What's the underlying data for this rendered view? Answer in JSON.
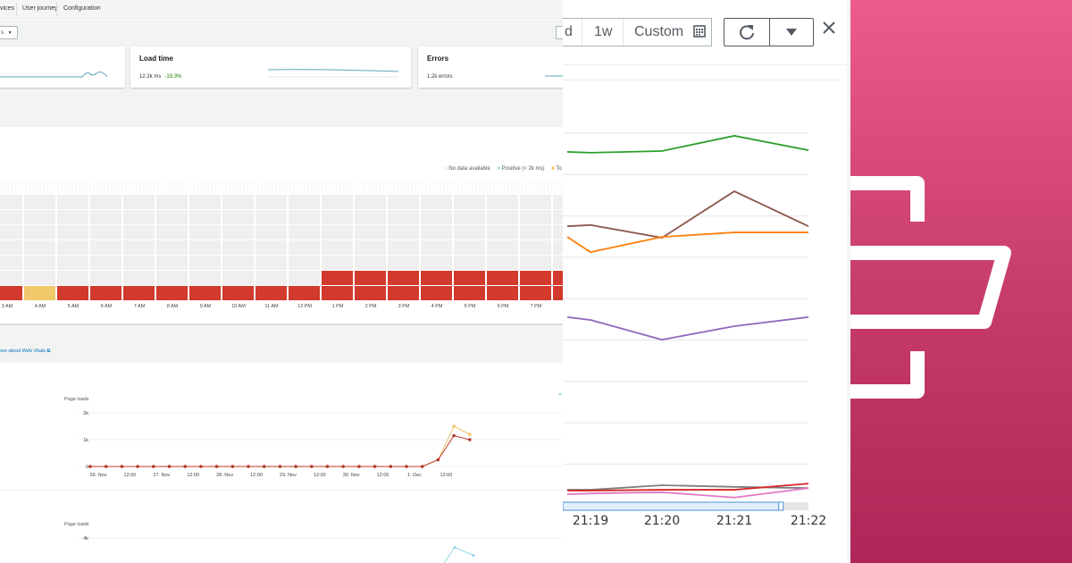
{
  "dashboard": {
    "tabs": [
      {
        "label": "vices"
      },
      {
        "label": "User journey"
      },
      {
        "label": "Configuration"
      }
    ],
    "filter_select": {
      "value": "s"
    },
    "cards": [
      {
        "title": "",
        "value": ""
      },
      {
        "title": "Load time",
        "value": "12.2k ms",
        "delta": "-19.3%"
      },
      {
        "title": "Errors",
        "value": "1.2k errors"
      }
    ],
    "legend": [
      {
        "label": "No data available",
        "color": "#e9ebed"
      },
      {
        "label": "Positive (< 2k ms)",
        "color": "#a8dcea"
      },
      {
        "label": "To",
        "color": "#f2c14e"
      }
    ],
    "heatmap": {
      "colors": {
        "none": "#efefef",
        "poor": "#d13a2c",
        "tolerable": "#efc96a"
      },
      "columns": [
        {
          "label": "3 AM",
          "cells": [
            "poor",
            "none",
            "none",
            "none",
            "none",
            "none",
            "none"
          ]
        },
        {
          "label": "4 AM",
          "cells": [
            "tolerable",
            "none",
            "none",
            "none",
            "none",
            "none",
            "none"
          ]
        },
        {
          "label": "5 AM",
          "cells": [
            "poor",
            "none",
            "none",
            "none",
            "none",
            "none",
            "none"
          ]
        },
        {
          "label": "6 AM",
          "cells": [
            "poor",
            "none",
            "none",
            "none",
            "none",
            "none",
            "none"
          ]
        },
        {
          "label": "7 AM",
          "cells": [
            "poor",
            "none",
            "none",
            "none",
            "none",
            "none",
            "none"
          ]
        },
        {
          "label": "8 AM",
          "cells": [
            "poor",
            "none",
            "none",
            "none",
            "none",
            "none",
            "none"
          ]
        },
        {
          "label": "9 AM",
          "cells": [
            "poor",
            "none",
            "none",
            "none",
            "none",
            "none",
            "none"
          ]
        },
        {
          "label": "10 AM",
          "cells": [
            "poor",
            "none",
            "none",
            "none",
            "none",
            "none",
            "none"
          ]
        },
        {
          "label": "11 AM",
          "cells": [
            "poor",
            "none",
            "none",
            "none",
            "none",
            "none",
            "none"
          ]
        },
        {
          "label": "12 PM",
          "cells": [
            "poor",
            "none",
            "none",
            "none",
            "none",
            "none",
            "none"
          ]
        },
        {
          "label": "1 PM",
          "cells": [
            "poor",
            "poor",
            "none",
            "none",
            "none",
            "none",
            "none"
          ]
        },
        {
          "label": "2 PM",
          "cells": [
            "poor",
            "poor",
            "none",
            "none",
            "none",
            "none",
            "none"
          ]
        },
        {
          "label": "3 PM",
          "cells": [
            "poor",
            "poor",
            "none",
            "none",
            "none",
            "none",
            "none"
          ]
        },
        {
          "label": "4 PM",
          "cells": [
            "poor",
            "poor",
            "none",
            "none",
            "none",
            "none",
            "none"
          ]
        },
        {
          "label": "5 PM",
          "cells": [
            "poor",
            "poor",
            "none",
            "none",
            "none",
            "none",
            "none"
          ]
        },
        {
          "label": "6 PM",
          "cells": [
            "poor",
            "poor",
            "none",
            "none",
            "none",
            "none",
            "none"
          ]
        },
        {
          "label": "7 PM",
          "cells": [
            "poor",
            "poor",
            "none",
            "none",
            "none",
            "none",
            "none"
          ]
        },
        {
          "label": "",
          "cells": [
            "poor",
            "poor",
            "none",
            "none",
            "none",
            "none",
            "none"
          ]
        }
      ]
    },
    "web_vitals_link": "ore about Web Vitals"
  },
  "chart_data": [
    {
      "type": "line",
      "ylabel": "Page loads",
      "yticks": [
        "0",
        "1k",
        "2k"
      ],
      "ylim": [
        0,
        2000
      ],
      "xticks": [
        "26. Nov",
        "12:00",
        "27. Nov",
        "12:00",
        "28. Nov",
        "12:00",
        "29. Nov",
        "12:00",
        "30. Nov",
        "12:00",
        "1. Dec",
        "12:00"
      ],
      "x": [
        "25 Nov 21:00",
        "26 Nov 03:00",
        "26 Nov 09:00",
        "26 Nov 15:00",
        "26 Nov 21:00",
        "27 Nov 03:00",
        "27 Nov 09:00",
        "27 Nov 15:00",
        "27 Nov 21:00",
        "28 Nov 03:00",
        "28 Nov 09:00",
        "28 Nov 15:00",
        "28 Nov 21:00",
        "29 Nov 03:00",
        "29 Nov 09:00",
        "29 Nov 15:00",
        "29 Nov 21:00",
        "30 Nov 03:00",
        "30 Nov 09:00",
        "30 Nov 15:00",
        "30 Nov 21:00",
        "1 Dec 03:00",
        "1 Dec 09:00",
        "1 Dec 15:00",
        "1 Dec 21:00"
      ],
      "series": [
        {
          "color": "#f0c36b",
          "values": [
            0,
            0,
            0,
            0,
            0,
            0,
            0,
            0,
            0,
            0,
            0,
            0,
            0,
            0,
            0,
            0,
            0,
            0,
            0,
            0,
            0,
            0,
            250,
            1500,
            1200
          ]
        },
        {
          "color": "#c0392b",
          "values": [
            0,
            0,
            0,
            0,
            0,
            0,
            0,
            0,
            0,
            0,
            0,
            0,
            0,
            0,
            0,
            0,
            0,
            0,
            0,
            0,
            0,
            0,
            250,
            1150,
            1000
          ]
        }
      ]
    },
    {
      "type": "line",
      "ylabel": "Page loads",
      "yticks": [
        "4k"
      ],
      "series": [
        {
          "color": "#8fd8e6",
          "x": [
            "1 Dec 09:00",
            "1 Dec 15:00",
            "1 Dec 21:00"
          ],
          "values": [
            1500,
            3300,
            2700
          ]
        }
      ]
    },
    {
      "type": "line",
      "xticks": [
        "21:19",
        "21:20",
        "21:21",
        "21:22"
      ],
      "x": [
        "21:18:42",
        "21:19:00",
        "21:20:00",
        "21:21:00",
        "21:22:00"
      ],
      "ylim": [
        0,
        100
      ],
      "grid": true,
      "series": [
        {
          "color": "#2ca02c",
          "values": [
            84.8,
            84.6,
            85,
            88.7,
            85.2
          ]
        },
        {
          "color": "#8c564b",
          "values": [
            66.7,
            67,
            63.9,
            75.2,
            66.7
          ]
        },
        {
          "color": "#ff7f0e",
          "values": [
            64.1,
            60.4,
            64.1,
            65.2,
            65.2
          ]
        },
        {
          "color": "#9467bd",
          "values": [
            44.6,
            43.9,
            39.1,
            42.4,
            44.6
          ]
        },
        {
          "color": "#7f7f7f",
          "values": [
            2.6,
            2.6,
            3.7,
            3.3,
            3.0
          ]
        },
        {
          "color": "#d62728",
          "values": [
            2.4,
            2.4,
            2.6,
            2.6,
            4.1
          ]
        },
        {
          "color": "#e377c2",
          "values": [
            1.5,
            1.7,
            2.0,
            0.7,
            3.0
          ]
        }
      ],
      "range_selector_fraction": 0.89
    }
  ],
  "metrics_toolbar": {
    "periods": [
      {
        "label": "d"
      },
      {
        "label": "1w"
      },
      {
        "label": "Custom"
      }
    ],
    "icons": {
      "calendar": "calendar-icon",
      "refresh": "refresh-icon",
      "dropdown": "caret-down-icon",
      "close": "close-icon"
    }
  },
  "service_logo": {
    "icon": "service-bracket-logo",
    "gradient": [
      "#ec5c8b",
      "#b02557"
    ]
  }
}
